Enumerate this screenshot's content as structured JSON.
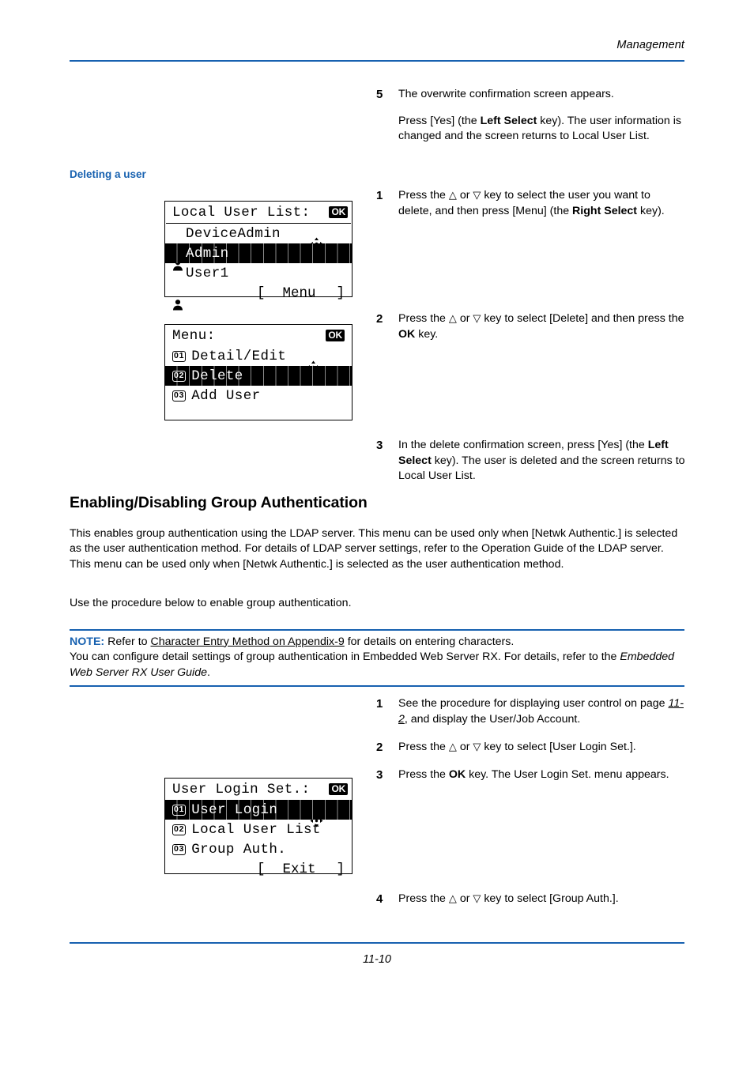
{
  "header": {
    "title": "Management"
  },
  "footer": {
    "page_number": "11-10"
  },
  "subheading_deleting": "Deleting a user",
  "section_heading": "Enabling/Disabling Group Authentication",
  "body_paragraph": "This enables group authentication using the LDAP server. This menu can be used only when [Netwk Authentic.] is selected as the user authentication method. For details of LDAP server settings, refer to the Operation Guide of the LDAP server. This menu can be used only when [Netwk Authentic.] is selected as the user authentication method.",
  "body_paragraph2": "Use the procedure below to enable group authentication.",
  "note": {
    "label": "NOTE:",
    "text_before_link": " Refer to ",
    "link": "Character Entry Method on Appendix-9",
    "text_after_link": " for details on entering characters.",
    "line2": "You can configure detail settings of group authentication in Embedded Web Server RX. For details, refer to the ",
    "line2_italic": "Embedded Web Server RX User Guide",
    "line2_end": "."
  },
  "steps_top": [
    {
      "num": "5",
      "p1": "The overwrite confirmation screen appears.",
      "p2_a": "Press [Yes] (the ",
      "p2_b": "Left Select",
      "p2_c": " key). The user information is changed and the screen returns to Local User List."
    }
  ],
  "steps_delete": [
    {
      "num": "1",
      "a": "Press the ",
      "up": "△",
      "mid": " or ",
      "down": "▽",
      "b": " key to select the user you want to delete, and then press [Menu] (the ",
      "bold": "Right Select",
      "c": " key)."
    },
    {
      "num": "2",
      "a": "Press the ",
      "up": "△",
      "mid": " or ",
      "down": "▽",
      "b": " key to select [Delete] and then press the ",
      "bold": "OK",
      "c": " key."
    },
    {
      "num": "3",
      "a": "In the delete confirmation screen, press [Yes] (the ",
      "bold": "Left Select",
      "c": " key). The user is deleted and the screen returns to Local User List."
    }
  ],
  "steps_group": [
    {
      "num": "1",
      "a": "See the procedure for displaying user control on page ",
      "xref": "11-2",
      "c": ", and display the User/Job Account."
    },
    {
      "num": "2",
      "a": "Press the ",
      "up": "△",
      "mid": " or ",
      "down": "▽",
      "b": " key to select [User Login Set.]."
    },
    {
      "num": "3",
      "a": "Press the ",
      "bold": "OK",
      "c": " key. The User Login Set. menu appears."
    },
    {
      "num": "4",
      "a": "Press the ",
      "up": "△",
      "mid": " or ",
      "down": "▽",
      "b": " key to select [Group Auth.]."
    }
  ],
  "lcd_local_user_list": {
    "title": "Local User List:",
    "rows": [
      {
        "label": "DeviceAdmin",
        "icon": "person-icon",
        "selected": false
      },
      {
        "label": "Admin",
        "icon": "person-icon",
        "selected": true
      },
      {
        "label": "User1",
        "icon": "person-icon",
        "selected": false
      }
    ],
    "softkey_left": "[",
    "softkey_center": "Menu",
    "softkey_right": "]"
  },
  "lcd_menu": {
    "title": "Menu:",
    "rows": [
      {
        "badge": "01",
        "label": "Detail/Edit",
        "selected": false
      },
      {
        "badge": "02",
        "label": "Delete",
        "selected": true
      },
      {
        "badge": "03",
        "label": "Add User",
        "selected": false
      }
    ]
  },
  "lcd_user_login_set": {
    "title": "User Login Set.:",
    "rows": [
      {
        "badge": "01",
        "label": "User Login",
        "selected": true
      },
      {
        "badge": "02",
        "label": "Local User List",
        "selected": false
      },
      {
        "badge": "03",
        "label": "Group Auth.",
        "selected": false
      }
    ],
    "softkey_left": "[",
    "softkey_center": "Exit",
    "softkey_right": "]"
  },
  "icons": {
    "nav_cross": "nav-cross-icon",
    "ok": "OK"
  },
  "colors": {
    "accent_blue": "#1761b0",
    "text": "#000000",
    "page_bg": "#ffffff"
  }
}
